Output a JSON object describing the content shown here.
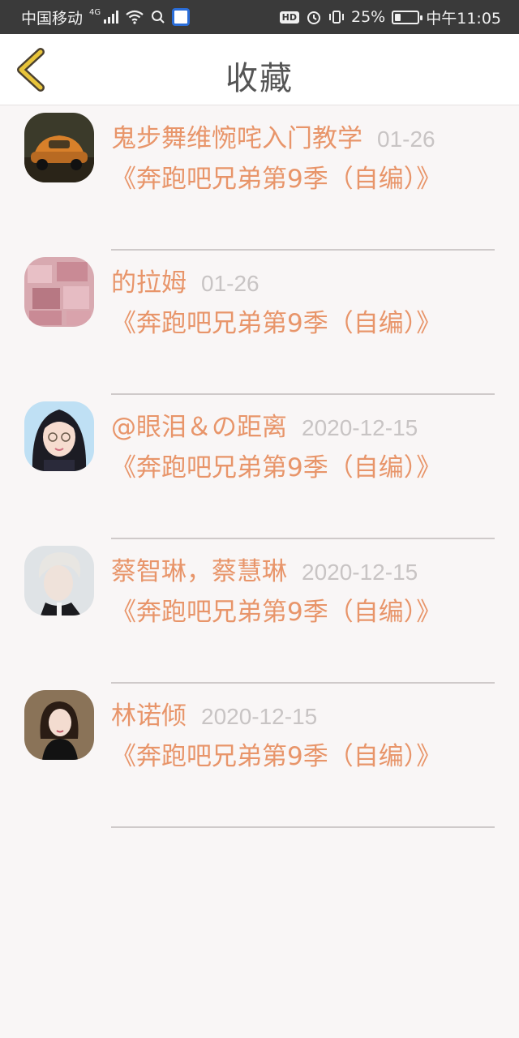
{
  "status_bar": {
    "carrier": "中国移动",
    "network": "4G",
    "hd": "HD",
    "battery_text": "25%",
    "battery_level": 25,
    "time": "中午11:05"
  },
  "header": {
    "title": "收藏",
    "accent_color": "#e8c43a"
  },
  "favorites": [
    {
      "name": "鬼步舞维惋咤入门教学",
      "date": "01-26",
      "title": "《奔跑吧兄弟第9季（自编）》",
      "avatar": "car-avatar"
    },
    {
      "name": "的拉姆",
      "date": "01-26",
      "title": "《奔跑吧兄弟第9季（自编）》",
      "avatar": "money-avatar"
    },
    {
      "name": "@眼泪＆の距离",
      "date": "2020-12-15",
      "title": "《奔跑吧兄弟第9季（自编）》",
      "avatar": "anime-girl-avatar"
    },
    {
      "name": "蔡智琳，蔡慧琳",
      "date": "2020-12-15",
      "title": "《奔跑吧兄弟第9季（自编）》",
      "avatar": "man-portrait-avatar"
    },
    {
      "name": "林诺倾",
      "date": "2020-12-15",
      "title": "《奔跑吧兄弟第9季（自编）》",
      "avatar": "woman-portrait-avatar"
    }
  ]
}
